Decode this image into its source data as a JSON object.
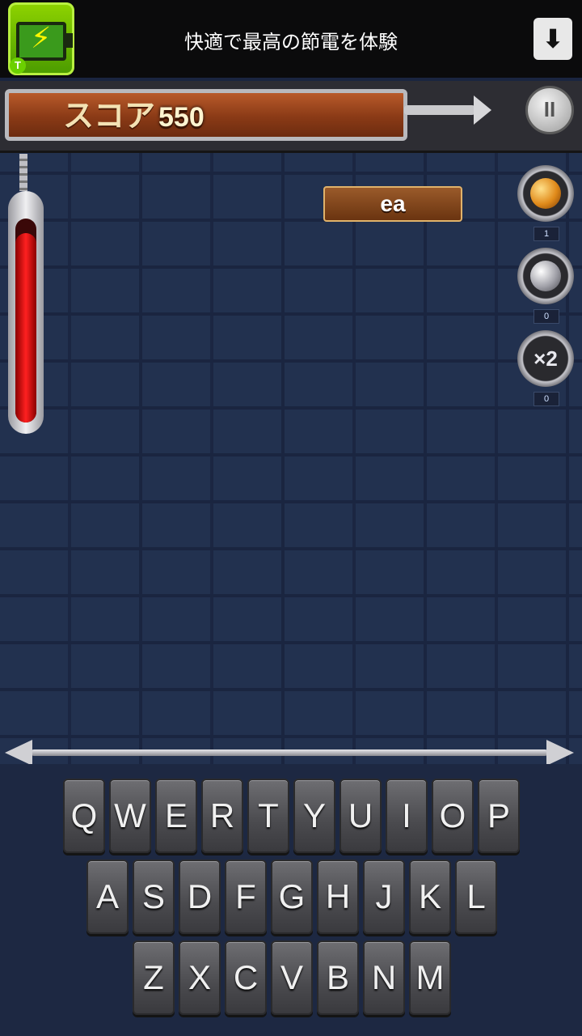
{
  "ad": {
    "text": "快適で最高の節電を体験",
    "icon_bolt": "⚡",
    "icon_tag": "T",
    "download_glyph": "⬇"
  },
  "hud": {
    "score_label": "スコア",
    "score_value": "550",
    "pause_glyph": "II"
  },
  "health": {
    "level": 0.93
  },
  "word": "ea",
  "powerups": [
    {
      "name": "bomb",
      "count": "1"
    },
    {
      "name": "shield",
      "count": "0"
    },
    {
      "name": "multiplier",
      "label": "×2",
      "count": "0"
    }
  ],
  "keyboard": {
    "row1": [
      "Q",
      "W",
      "E",
      "R",
      "T",
      "Y",
      "U",
      "I",
      "O",
      "P"
    ],
    "row2": [
      "A",
      "S",
      "D",
      "F",
      "G",
      "H",
      "J",
      "K",
      "L"
    ],
    "row3": [
      "Z",
      "X",
      "C",
      "V",
      "B",
      "N",
      "M"
    ]
  }
}
